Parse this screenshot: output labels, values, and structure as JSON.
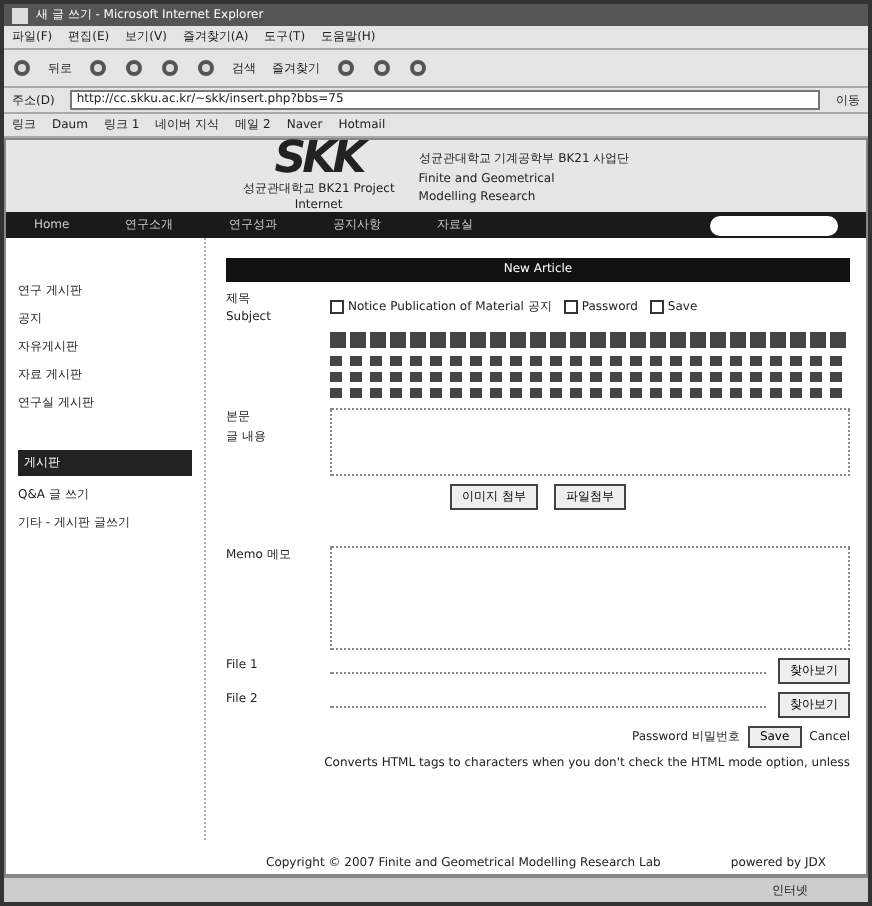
{
  "window": {
    "title": "새 글 쓰기 - Microsoft Internet Explorer"
  },
  "menu": [
    "파일(F)",
    "편집(E)",
    "보기(V)",
    "즐겨찾기(A)",
    "도구(T)",
    "도움말(H)"
  ],
  "toolbar": {
    "back": "뒤로",
    "search": "검색",
    "favorites": "즐겨찾기"
  },
  "address": {
    "label": "주소(D)",
    "url": "http://cc.skku.ac.kr/~skk/insert.php?bbs=75",
    "go": "이동"
  },
  "links": {
    "label": "링크",
    "items": [
      "Daum",
      "링크 1",
      "네이버 지식",
      "메일 2",
      "Naver",
      "Hotmail"
    ]
  },
  "header": {
    "logo": "SKK",
    "project": "성균관대학교 BK21 Project",
    "sub": "Internet",
    "lines": [
      "성균관대학교 기계공학부 BK21 사업단",
      "Finite and Geometrical",
      "Modelling Research"
    ]
  },
  "nav": {
    "items": [
      "Home",
      "연구소개",
      "연구성과",
      "공지사항",
      "자료실"
    ]
  },
  "sidebar": {
    "title": "연구 게시판",
    "items": [
      "공지",
      "자유게시판",
      "자료 게시판",
      "연구실 게시판"
    ],
    "section": "게시판",
    "sub_items": [
      "Q&A 글 쓰기",
      "기타 - 게시판 글쓰기"
    ]
  },
  "form": {
    "title": "New Article",
    "subject_label": "제목",
    "subject_sub": "Subject",
    "options": [
      {
        "label": "Notice Publication of Material 공지",
        "checked": false
      },
      {
        "label": "Password",
        "checked": false
      },
      {
        "label": "Save",
        "checked": false
      }
    ],
    "content_label": "본문",
    "content_sub": "글 내용",
    "buttons": [
      "이미지 첨부",
      "파일첨부"
    ],
    "memo_label": "Memo 메모",
    "file_labels": [
      "File 1",
      "File 2"
    ],
    "browse": [
      "찾아보기",
      "찾아보기"
    ],
    "password_label": "Password 비밀번호",
    "save": "Save",
    "cancel": "Cancel",
    "note": "Converts HTML tags to characters when you don't check the HTML mode option, unless"
  },
  "footer": {
    "copyright": "Copyright © 2007 Finite and Geometrical Modelling Research Lab",
    "by": "powered by JDX"
  },
  "status": {
    "zone": "인터넷"
  }
}
